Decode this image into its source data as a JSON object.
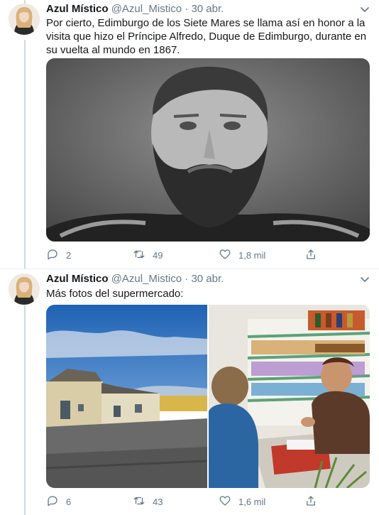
{
  "tweets": [
    {
      "author_name": "Azul Místico",
      "handle": "@Azul_Mistico",
      "separator": "·",
      "date": "30 abr.",
      "text": "Por cierto, Edimburgo de los Siete Mares se llama así en honor a la visita que hizo el Príncipe Alfredo, Duque de Edimburgo, durante en su vuelta al mundo en 1867.",
      "replies": "2",
      "retweets": "49",
      "likes": "1,8 mil"
    },
    {
      "author_name": "Azul Místico",
      "handle": "@Azul_Mistico",
      "separator": "·",
      "date": "30 abr.",
      "text": "Más fotos del supermercado:",
      "replies": "6",
      "retweets": "43",
      "likes": "1,6 mil"
    }
  ],
  "icons": {
    "reply": "reply-icon",
    "retweet": "retweet-icon",
    "like": "heart-icon",
    "share": "share-icon",
    "menu": "chevron-down-icon"
  },
  "colors": {
    "text_primary": "#14171a",
    "text_secondary": "#657786",
    "thread_line": "#cfd9de",
    "separator": "#e6ecf0"
  }
}
